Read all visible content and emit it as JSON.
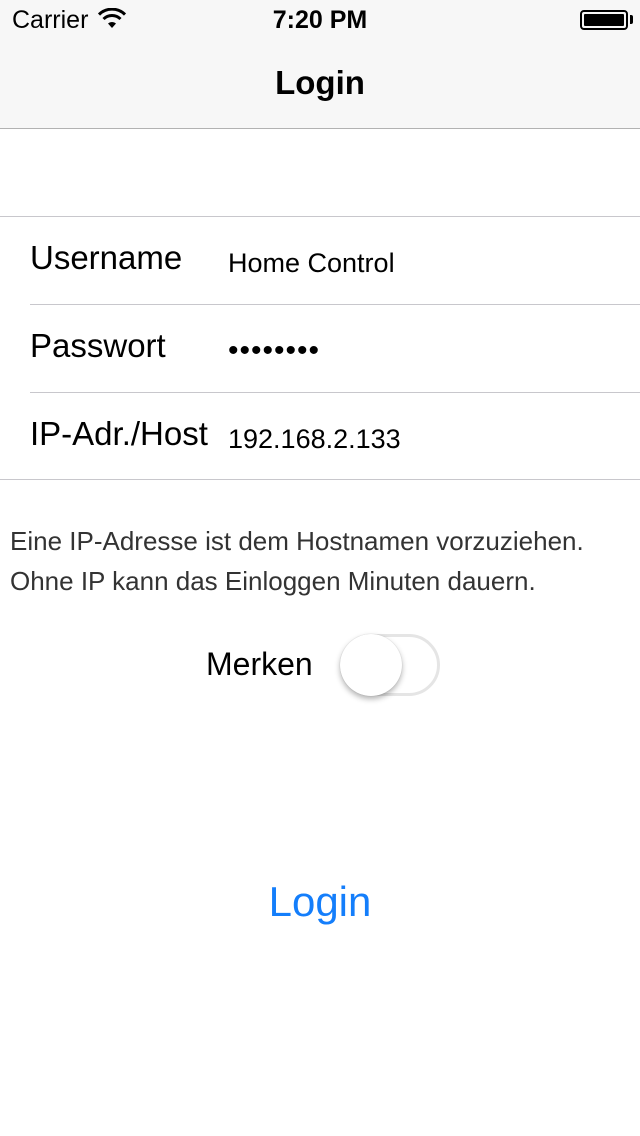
{
  "status_bar": {
    "carrier": "Carrier",
    "time": "7:20 PM",
    "wifi_icon": "wifi-icon",
    "battery_icon": "battery-icon",
    "battery_level": 1.0
  },
  "nav": {
    "title": "Login"
  },
  "form": {
    "username": {
      "label": "Username",
      "value": "Home Control"
    },
    "password": {
      "label": "Passwort",
      "value": "••••••••"
    },
    "host": {
      "label": "IP-Adr./Host",
      "value": "192.168.2.133"
    }
  },
  "hint": {
    "line1": "Eine IP-Adresse ist dem Hostnamen vorzuziehen.",
    "line2": "Ohne IP kann das Einloggen Minuten dauern."
  },
  "remember": {
    "label": "Merken",
    "on": false
  },
  "login_button": {
    "label": "Login"
  },
  "colors": {
    "accent": "#147efb",
    "separator": "#c8c7cc",
    "bar_background": "#f7f7f7"
  }
}
